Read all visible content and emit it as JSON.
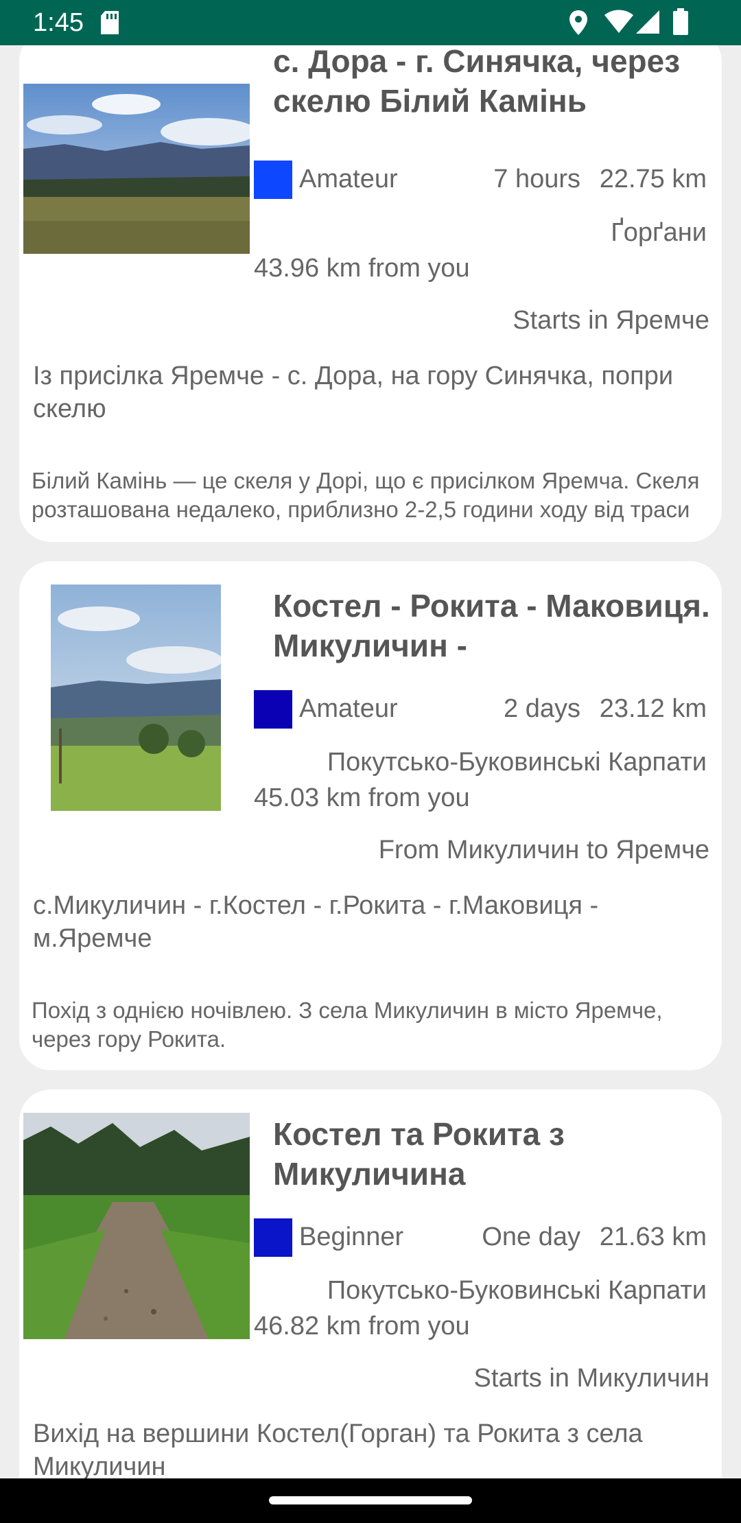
{
  "status_bar": {
    "time": "1:45",
    "icons": [
      "sd-card-icon",
      "location-icon",
      "wifi-icon",
      "signal-icon",
      "battery-icon"
    ],
    "background": "#006653"
  },
  "routes": [
    {
      "title": "с. Дора - г. Синячка, через скелю Білий Камінь",
      "difficulty": "Amateur",
      "difficulty_color": "#0d47ff",
      "duration": "7 hours",
      "distance": "22.75 km",
      "region": "Ґорґани",
      "from_you": "43.96 km from you",
      "start": "Starts in Яремче",
      "subtitle": "Із присілка Яремче - с. Дора, на гору Синячка, попри скелю",
      "description": "Білий Камінь — це скеля у Дорі, що є присілком Яремча. Скеля розташована недалеко, приблизно 2-2,5 години ходу від траси"
    },
    {
      "title": "Костел - Рокита - Маковиця. Микуличин -",
      "difficulty": "Amateur",
      "difficulty_color": "#0a00b4",
      "duration": "2 days",
      "distance": "23.12 km",
      "region": "Покутсько-Буковинські Карпати",
      "from_you": "45.03 km from you",
      "start": "From Микуличин to Яремче",
      "subtitle": "с.Микуличин - г.Костел - г.Рокита - г.Маковиця - м.Яремче",
      "description": "Похід з однією ночівлею. З села Микуличин в місто Яремче, через гору Рокита."
    },
    {
      "title": "Костел та Рокита з Микуличина",
      "difficulty": "Beginner",
      "difficulty_color": "#0a14c8",
      "duration": "One day",
      "distance": "21.63 km",
      "region": "Покутсько-Буковинські Карпати",
      "from_you": "46.82 km from you",
      "start": "Starts in Микуличин",
      "subtitle": "Вихід на вершини Костел(Горган) та Рокита з села Микуличин",
      "description": ""
    }
  ]
}
